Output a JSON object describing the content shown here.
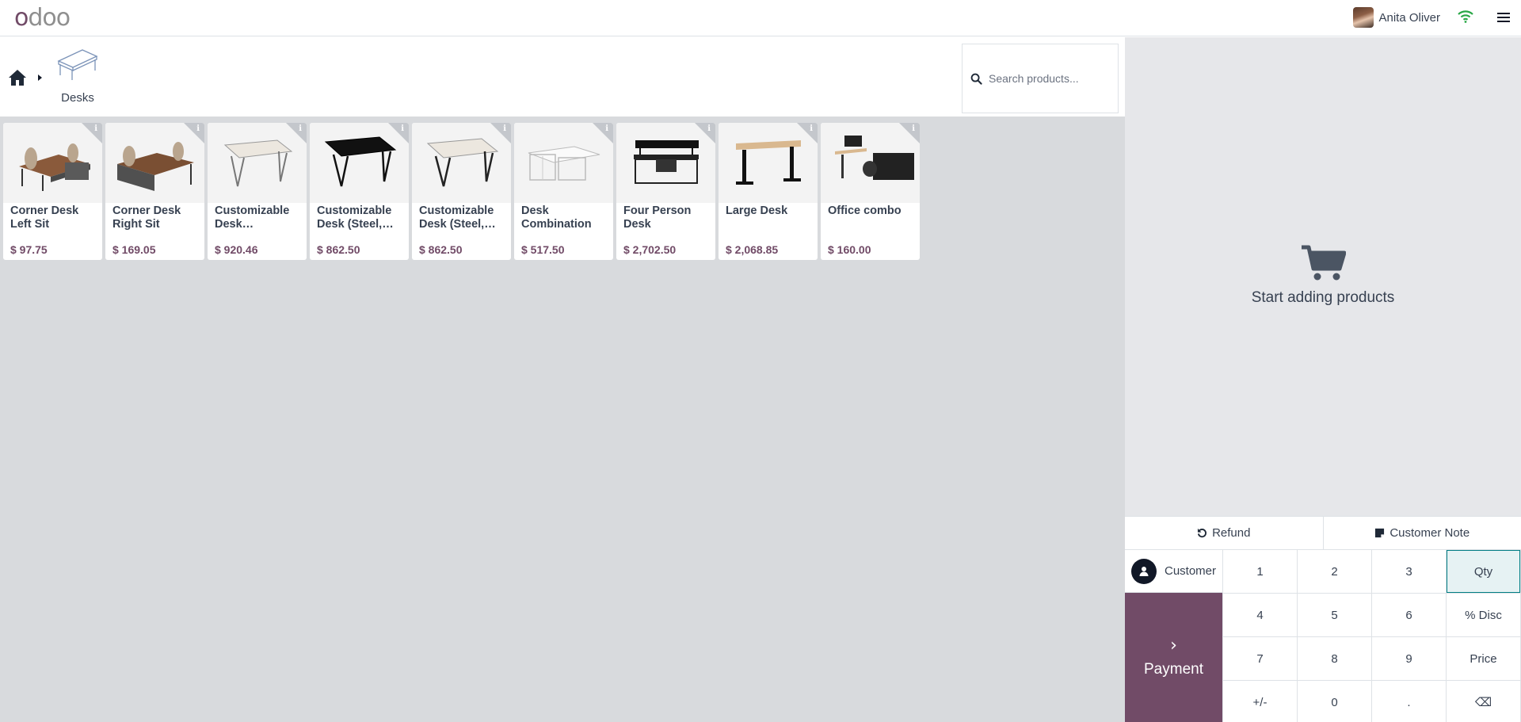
{
  "navbar": {
    "logo_text": [
      "o",
      "d",
      "o",
      "o"
    ],
    "user_name": "Anita Oliver",
    "colors": {
      "brand": "#714B67",
      "wifi": "#28a745"
    }
  },
  "categories": {
    "breadcrumb_home_icon": "home-icon",
    "current": {
      "label": "Desks",
      "icon": "desk-icon"
    }
  },
  "search": {
    "placeholder": "Search products..."
  },
  "products": [
    {
      "name": "Corner Desk Left Sit",
      "price": "$ 97.75"
    },
    {
      "name": "Corner Desk Right Sit",
      "price": "$ 169.05"
    },
    {
      "name": "Customizable Desk…",
      "price": "$ 920.46"
    },
    {
      "name": "Customizable Desk (Steel,…",
      "price": "$ 862.50"
    },
    {
      "name": "Customizable Desk (Steel,…",
      "price": "$ 862.50"
    },
    {
      "name": "Desk Combination",
      "price": "$ 517.50"
    },
    {
      "name": "Four Person Desk",
      "price": "$ 2,702.50"
    },
    {
      "name": "Large Desk",
      "price": "$ 2,068.85"
    },
    {
      "name": "Office combo",
      "price": "$ 160.00"
    }
  ],
  "product_info_glyph": "i",
  "order": {
    "empty_text": "Start adding products"
  },
  "actions": {
    "refund": "Refund",
    "customer_note": "Customer Note"
  },
  "pad": {
    "customer": "Customer",
    "payment": "Payment",
    "payment_chevron": "›",
    "keys": [
      "1",
      "2",
      "3",
      "Qty",
      "4",
      "5",
      "6",
      "% Disc",
      "7",
      "8",
      "9",
      "Price",
      "+/-",
      "0",
      ".",
      "⌫"
    ],
    "active_key": "Qty"
  }
}
